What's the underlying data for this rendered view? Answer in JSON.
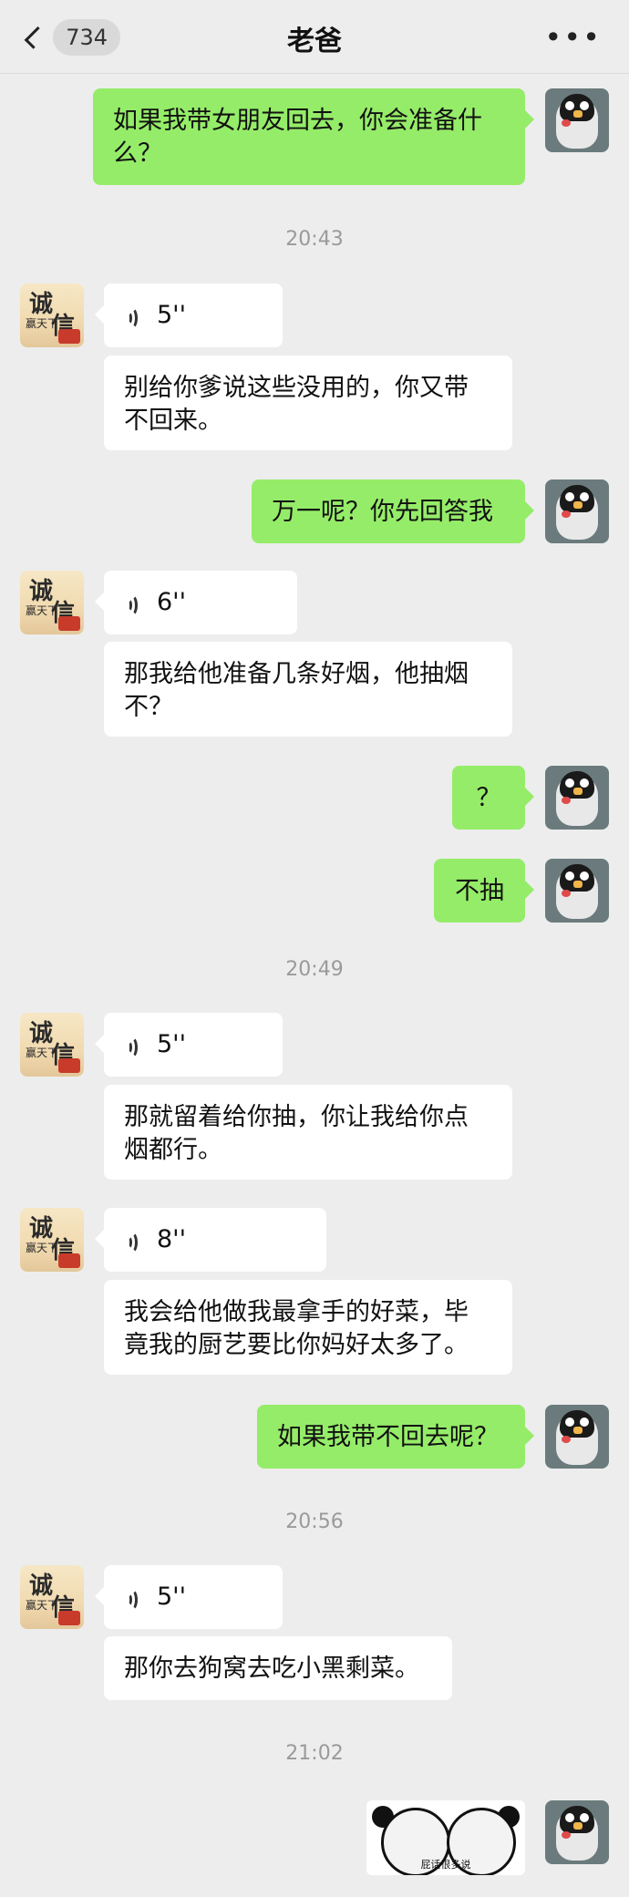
{
  "header": {
    "back_badge": "734",
    "title": "老爸",
    "more_glyph": "•••"
  },
  "messages": [
    {
      "side": "right",
      "type": "text",
      "text": "如果我带女朋友回去，你会准备什么？"
    },
    {
      "type": "time",
      "text": "20:43"
    },
    {
      "side": "left",
      "type": "voice",
      "duration": "5''"
    },
    {
      "side": "left",
      "type": "text",
      "text": "别给你爹说这些没用的，你又带不回来。"
    },
    {
      "side": "right",
      "type": "text",
      "text": "万一呢？你先回答我"
    },
    {
      "side": "left",
      "type": "voice",
      "duration": "6''"
    },
    {
      "side": "left",
      "type": "text",
      "text": "那我给他准备几条好烟，他抽烟不？"
    },
    {
      "side": "right",
      "type": "text",
      "text": "？"
    },
    {
      "side": "right",
      "type": "text",
      "text": "不抽"
    },
    {
      "type": "time",
      "text": "20:49"
    },
    {
      "side": "left",
      "type": "voice",
      "duration": "5''"
    },
    {
      "side": "left",
      "type": "text",
      "text": "那就留着给你抽，你让我给你点烟都行。"
    },
    {
      "side": "left",
      "type": "voice",
      "duration": "8''"
    },
    {
      "side": "left",
      "type": "text",
      "text": "我会给他做我最拿手的好菜，毕竟我的厨艺要比你妈好太多了。"
    },
    {
      "side": "right",
      "type": "text",
      "text": "如果我带不回去呢？"
    },
    {
      "type": "time",
      "text": "20:56"
    },
    {
      "side": "left",
      "type": "voice",
      "duration": "5''"
    },
    {
      "side": "left",
      "type": "text",
      "text": "那你去狗窝去吃小黑剩菜。"
    },
    {
      "type": "time",
      "text": "21:02"
    },
    {
      "side": "right",
      "type": "sticker",
      "caption": "屁话很多说"
    }
  ],
  "avatars": {
    "father": {
      "char1": "诚",
      "char2": "信",
      "small": "赢天下"
    }
  },
  "colors": {
    "background": "#ededed",
    "self_bubble": "#95ec69",
    "other_bubble": "#ffffff",
    "timestamp_text": "#9a9a9a"
  }
}
